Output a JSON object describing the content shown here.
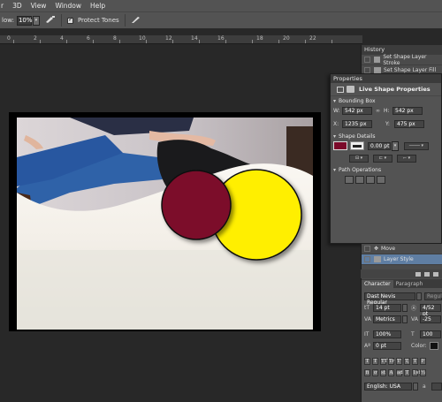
{
  "menu": [
    "r",
    "3D",
    "View",
    "Window",
    "Help"
  ],
  "options": {
    "flow_label": "low:",
    "flow_value": "10%",
    "protect_tones_label": "Protect Tones"
  },
  "ruler_ticks": [
    "0",
    "2",
    "4",
    "6",
    "8",
    "10",
    "12",
    "14",
    "16",
    "18",
    "20",
    "22"
  ],
  "history": {
    "title": "History",
    "items": [
      "Set Shape Layer Stroke",
      "Set Shape Layer Fill"
    ]
  },
  "properties": {
    "tab": "Properties",
    "subtitle": "Live Shape Properties",
    "bounding_box_label": "Bounding Box",
    "w_label": "W:",
    "w_value": "542 px",
    "h_label": "H:",
    "h_value": "542 px",
    "x_label": "X:",
    "x_value": "1235 px",
    "y_label": "Y:",
    "y_value": "475 px",
    "shape_details_label": "Shape Details",
    "stroke_width": "0.00 pt",
    "path_operations_label": "Path Operations",
    "fill_color": "#7b0a2a"
  },
  "layers": {
    "items": [
      "Move",
      "Layer Style"
    ]
  },
  "character": {
    "tabs": [
      "Character",
      "Paragraph"
    ],
    "font_family": "Dast Nevis Regular",
    "font_style": "Regul",
    "size": "14 pt",
    "leading": "4/52 pt",
    "kerning": "Metrics",
    "tracking": "-25",
    "vscale": "100%",
    "hscale": "100",
    "baseline": "0 pt",
    "color_label": "Color:",
    "type_buttons": [
      "T",
      "T",
      "TT",
      "Tr",
      "T'",
      "T,",
      "T",
      "F"
    ],
    "ligature_buttons": [
      "fi",
      "ơ",
      "st",
      "A",
      "ad",
      "T",
      "1st",
      "½"
    ],
    "language": "English: USA",
    "aa": "a"
  },
  "canvas": {
    "circle_left_color": "#7b0a2a",
    "circle_right_color": "#ffef00"
  }
}
